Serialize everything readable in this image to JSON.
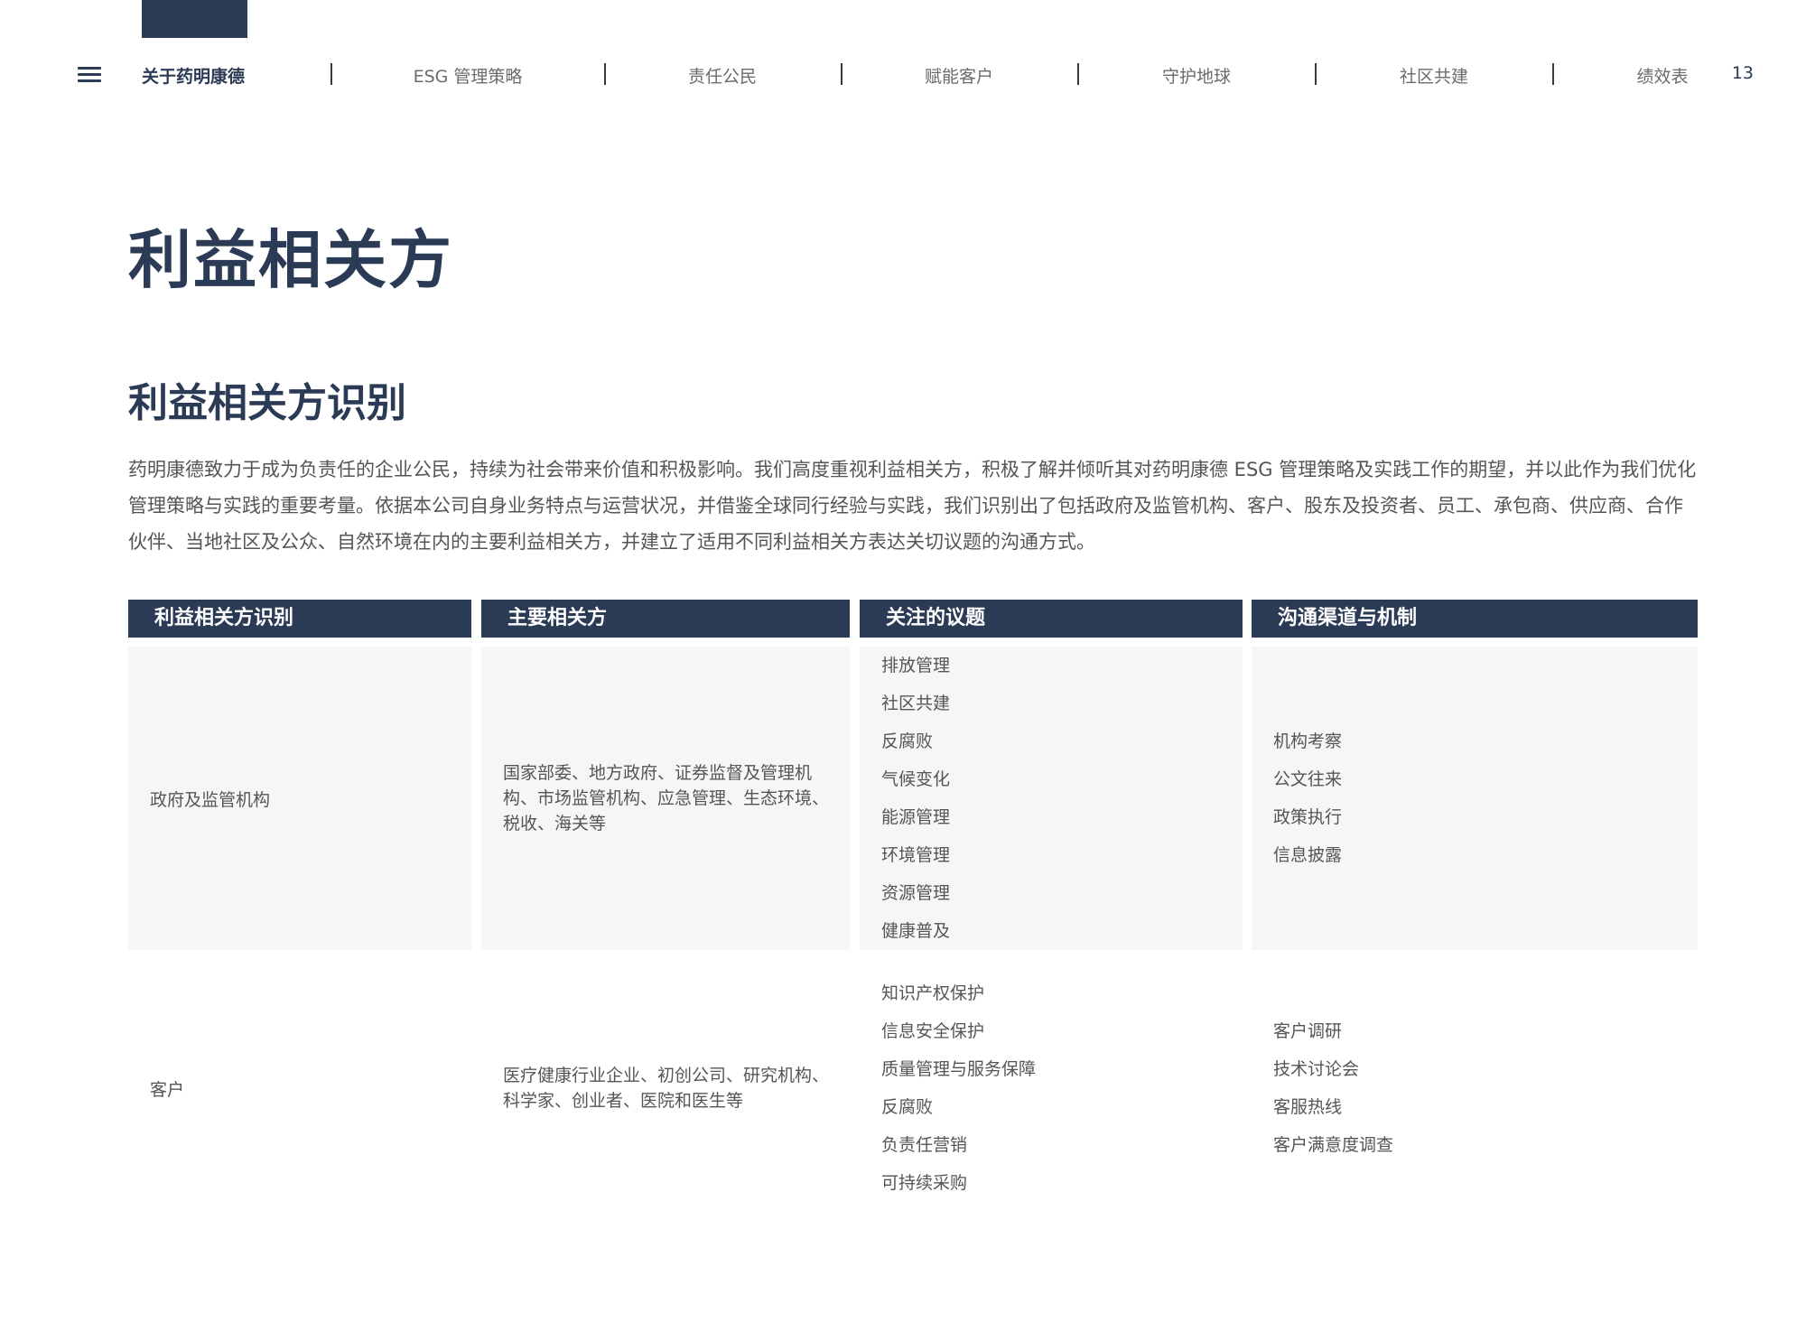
{
  "nav": {
    "items": [
      "关于药明康德",
      "ESG 管理策略",
      "责任公民",
      "赋能客户",
      "守护地球",
      "社区共建",
      "绩效表"
    ],
    "page_number": "13"
  },
  "page": {
    "title": "利益相关方",
    "section_title": "利益相关方识别",
    "intro": "药明康德致力于成为负责任的企业公民，持续为社会带来价值和积极影响。我们高度重视利益相关方，积极了解并倾听其对药明康德 ESG 管理策略及实践工作的期望，并以此作为我们优化管理策略与实践的重要考量。依据本公司自身业务特点与运营状况，并借鉴全球同行经验与实践，我们识别出了包括政府及监管机构、客户、股东及投资者、员工、承包商、供应商、合作伙伴、当地社区及公众、自然环境在内的主要利益相关方，并建立了适用不同利益相关方表达关切议题的沟通方式。"
  },
  "table": {
    "headers": [
      "利益相关方识别",
      "主要相关方",
      "关注的议题",
      "沟通渠道与机制"
    ],
    "rows": [
      {
        "stakeholder": "政府及监管机构",
        "parties": "国家部委、地方政府、证券监督及管理机构、市场监管机构、应急管理、生态环境、税收、海关等",
        "topics": [
          "排放管理",
          "社区共建",
          "反腐败",
          "气候变化",
          "能源管理",
          "环境管理",
          "资源管理",
          "健康普及"
        ],
        "channels": [
          "机构考察",
          "公文往来",
          "政策执行",
          "信息披露"
        ]
      },
      {
        "stakeholder": "客户",
        "parties": "医疗健康行业企业、初创公司、研究机构、科学家、创业者、医院和医生等",
        "topics": [
          "知识产权保护",
          "信息安全保护",
          "质量管理与服务保障",
          "反腐败",
          "负责任营销",
          "可持续采购"
        ],
        "channels": [
          "客户调研",
          "技术讨论会",
          "客服热线",
          "客户满意度调查"
        ]
      }
    ]
  }
}
